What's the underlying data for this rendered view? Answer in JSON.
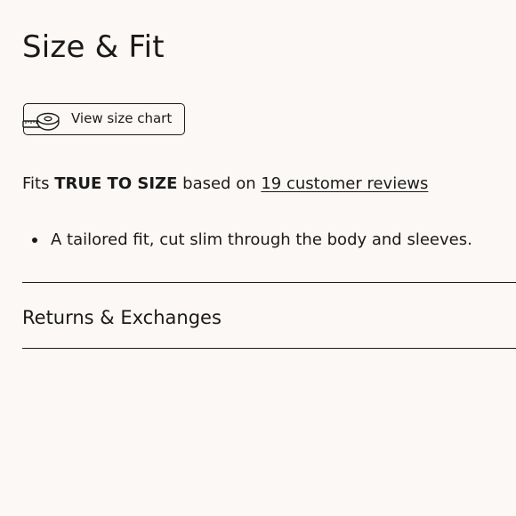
{
  "section": {
    "title": "Size & Fit"
  },
  "size_chart": {
    "icon": "measuring-tape-icon",
    "label": "View size chart"
  },
  "fit": {
    "prefix": "Fits",
    "rating": "TRUE TO SIZE",
    "middle": "based on",
    "reviews_link": "19 customer reviews"
  },
  "details": [
    "A tailored fit, cut slim through the body and sleeves."
  ],
  "accordion": {
    "returns_label": "Returns & Exchanges"
  },
  "colors": {
    "background": "#fcf8f5",
    "text": "#1a1a1a"
  }
}
